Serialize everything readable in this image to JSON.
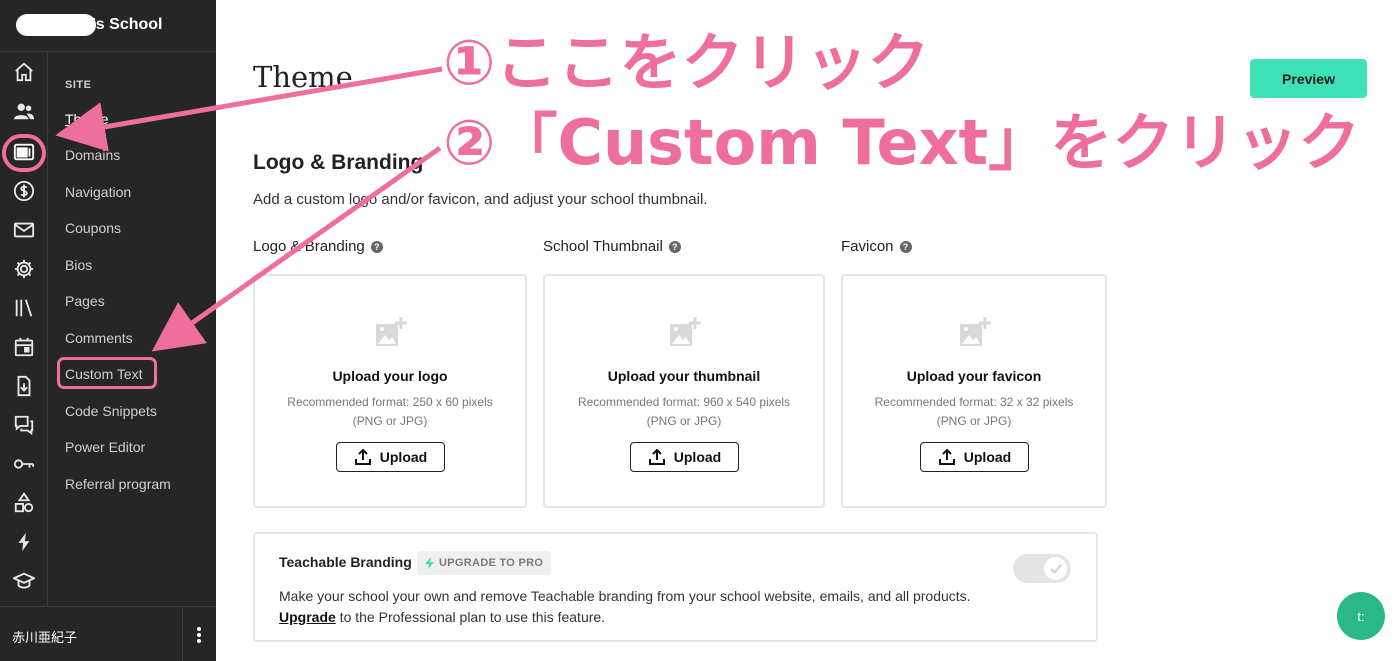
{
  "school": {
    "name_suffix": "'s School"
  },
  "rail_icons": [
    "home-icon",
    "users-icon",
    "site-icon",
    "dollar-icon",
    "mail-icon",
    "gear-icon",
    "library-icon",
    "calendar-icon",
    "download-icon",
    "comments-icon",
    "key-icon",
    "shapes-icon",
    "lightning-icon",
    "graduation-cap-icon"
  ],
  "site_menu": {
    "section_label": "SITE",
    "items": [
      {
        "label": "Theme",
        "active": true
      },
      {
        "label": "Domains"
      },
      {
        "label": "Navigation"
      },
      {
        "label": "Coupons"
      },
      {
        "label": "Bios"
      },
      {
        "label": "Pages"
      },
      {
        "label": "Comments"
      },
      {
        "label": "Custom Text"
      },
      {
        "label": "Code Snippets"
      },
      {
        "label": "Power Editor"
      },
      {
        "label": "Referral program"
      }
    ]
  },
  "user": {
    "name": "赤川亜紀子"
  },
  "header": {
    "title": "Theme",
    "preview_label": "Preview"
  },
  "logo_section": {
    "title": "Logo & Branding",
    "description": "Add a custom logo and/or favicon, and adjust your school thumbnail.",
    "columns": [
      {
        "label": "Logo & Branding",
        "card_title": "Upload your logo",
        "format_line1": "Recommended format: 250 x 60 pixels",
        "format_line2": "(PNG or JPG)",
        "button": "Upload"
      },
      {
        "label": "School Thumbnail",
        "card_title": "Upload your thumbnail",
        "format_line1": "Recommended format: 960 x 540 pixels",
        "format_line2": "(PNG or JPG)",
        "button": "Upload"
      },
      {
        "label": "Favicon",
        "card_title": "Upload your favicon",
        "format_line1": "Recommended format: 32 x 32 pixels",
        "format_line2": "(PNG or JPG)",
        "button": "Upload"
      }
    ]
  },
  "teachable_branding": {
    "title": "Teachable Branding",
    "badge": "UPGRADE TO PRO",
    "toggle_on": true,
    "description": "Make your school your own and remove Teachable branding from your school website, emails, and all products.",
    "upgrade_link": "Upgrade",
    "upgrade_rest": " to the Professional plan to use this feature."
  },
  "chat": {
    "label": "t:"
  },
  "annotations": {
    "step1": "①ここをクリック",
    "step2": "②「Custom Text」をクリック",
    "color": "#ee6e9e"
  },
  "colors": {
    "accent": "#3ee0b5",
    "sidebar": "#262626",
    "annotation": "#ee6e9e",
    "chat": "#2ab889"
  }
}
